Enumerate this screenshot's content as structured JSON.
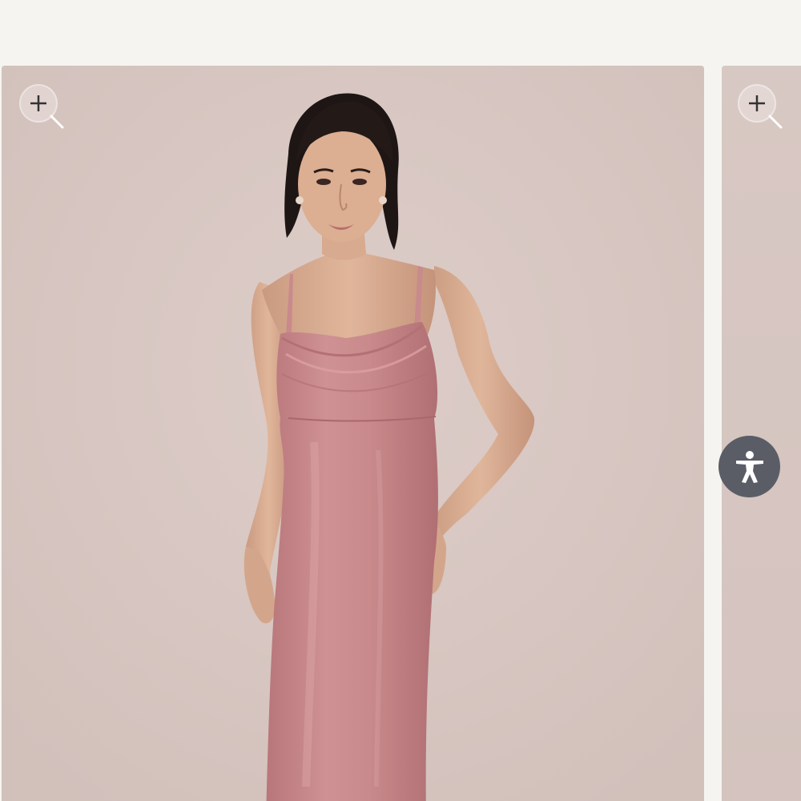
{
  "gallery": {
    "slides": [
      {
        "zoom_icon": "zoom-in-icon",
        "image_subject": "model-in-dusty-rose-velvet-cowl-neck-slip-dress"
      },
      {
        "zoom_icon": "zoom-in-icon"
      }
    ]
  },
  "accessibility": {
    "icon": "accessibility-person-icon",
    "color": "#5a5d66"
  },
  "colors": {
    "page_background": "#f5f4f0",
    "photo_backdrop": "#d7c7c2",
    "dress": "#c98a8c"
  }
}
